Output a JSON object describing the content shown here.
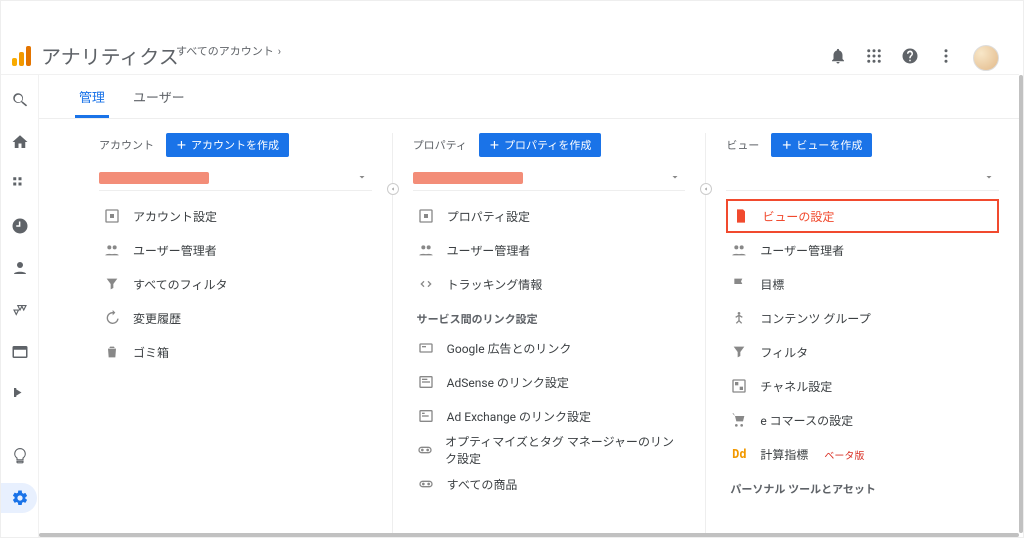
{
  "app": {
    "title": "アナリティクス"
  },
  "breadcrumb": {
    "text": "すべてのアカウント",
    "chevron": "›"
  },
  "tabs": {
    "admin": "管理",
    "user": "ユーザー"
  },
  "account": {
    "label": "アカウント",
    "create": "アカウントを作成",
    "items": {
      "settings": "アカウント設定",
      "users": "ユーザー管理者",
      "filters": "すべてのフィルタ",
      "history": "変更履歴",
      "trash": "ゴミ箱"
    }
  },
  "property": {
    "label": "プロパティ",
    "create": "プロパティを作成",
    "items": {
      "settings": "プロパティ設定",
      "users": "ユーザー管理者",
      "tracking": "トラッキング情報",
      "section_links": "サービス間のリンク設定",
      "ads": "Google 広告とのリンク",
      "adsense": "AdSense のリンク設定",
      "adexchange": "Ad Exchange のリンク設定",
      "optimize": "オプティマイズとタグ マネージャーのリンク設定",
      "all_products": "すべての商品"
    }
  },
  "view": {
    "label": "ビュー",
    "create": "ビューを作成",
    "items": {
      "settings": "ビューの設定",
      "users": "ユーザー管理者",
      "goals": "目標",
      "content_groups": "コンテンツ グループ",
      "filters": "フィルタ",
      "channel": "チャネル設定",
      "ecommerce": "e コマースの設定",
      "calc_metrics": "計算指標",
      "calc_metrics_beta": "ベータ版",
      "section_personal": "パーソナル ツールとアセット"
    }
  }
}
